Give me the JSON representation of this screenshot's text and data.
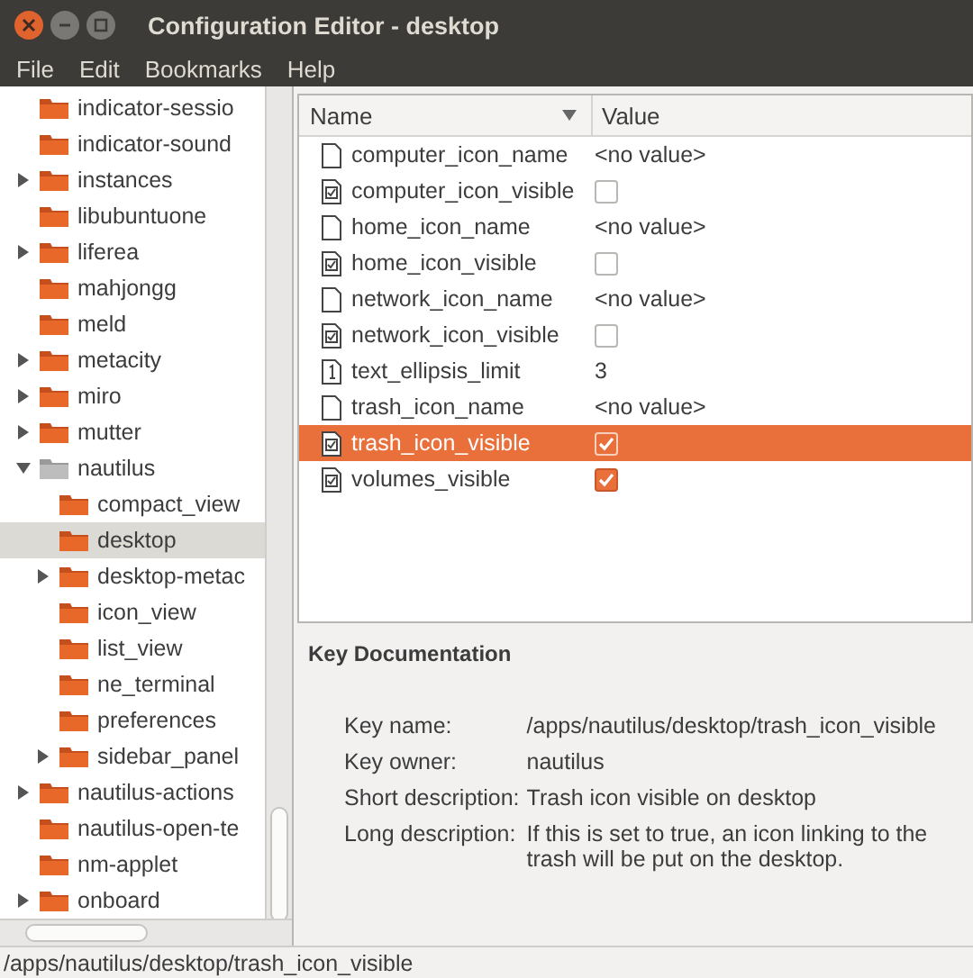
{
  "window": {
    "title": "Configuration Editor - desktop"
  },
  "menu": [
    "File",
    "Edit",
    "Bookmarks",
    "Help"
  ],
  "tree": [
    {
      "label": "indicator-sessio",
      "expandable": false,
      "expanded": false,
      "selected": false
    },
    {
      "label": "indicator-sound",
      "expandable": false,
      "expanded": false,
      "selected": false
    },
    {
      "label": "instances",
      "expandable": true,
      "expanded": false,
      "selected": false
    },
    {
      "label": "libubuntuone",
      "expandable": false,
      "expanded": false,
      "selected": false
    },
    {
      "label": "liferea",
      "expandable": true,
      "expanded": false,
      "selected": false
    },
    {
      "label": "mahjongg",
      "expandable": false,
      "expanded": false,
      "selected": false
    },
    {
      "label": "meld",
      "expandable": false,
      "expanded": false,
      "selected": false
    },
    {
      "label": "metacity",
      "expandable": true,
      "expanded": false,
      "selected": false
    },
    {
      "label": "miro",
      "expandable": true,
      "expanded": false,
      "selected": false
    },
    {
      "label": "mutter",
      "expandable": true,
      "expanded": false,
      "selected": false
    },
    {
      "label": "nautilus",
      "expandable": true,
      "expanded": true,
      "selected": false,
      "children": [
        {
          "label": "compact_view",
          "expandable": false,
          "expanded": false,
          "selected": false
        },
        {
          "label": "desktop",
          "expandable": false,
          "expanded": false,
          "selected": true
        },
        {
          "label": "desktop-metac",
          "expandable": true,
          "expanded": false,
          "selected": false
        },
        {
          "label": "icon_view",
          "expandable": false,
          "expanded": false,
          "selected": false
        },
        {
          "label": "list_view",
          "expandable": false,
          "expanded": false,
          "selected": false
        },
        {
          "label": "ne_terminal",
          "expandable": false,
          "expanded": false,
          "selected": false
        },
        {
          "label": "preferences",
          "expandable": false,
          "expanded": false,
          "selected": false
        },
        {
          "label": "sidebar_panel",
          "expandable": true,
          "expanded": false,
          "selected": false
        }
      ]
    },
    {
      "label": "nautilus-actions",
      "expandable": true,
      "expanded": false,
      "selected": false
    },
    {
      "label": "nautilus-open-te",
      "expandable": false,
      "expanded": false,
      "selected": false
    },
    {
      "label": "nm-applet",
      "expandable": false,
      "expanded": false,
      "selected": false
    },
    {
      "label": "onboard",
      "expandable": true,
      "expanded": false,
      "selected": false
    }
  ],
  "table": {
    "columns": [
      "Name",
      "Value"
    ],
    "rows": [
      {
        "kind": "string",
        "name": "computer_icon_name",
        "value": "<no value>",
        "selected": false
      },
      {
        "kind": "bool",
        "name": "computer_icon_visible",
        "checked": false,
        "selected": false
      },
      {
        "kind": "string",
        "name": "home_icon_name",
        "value": "<no value>",
        "selected": false
      },
      {
        "kind": "bool",
        "name": "home_icon_visible",
        "checked": false,
        "selected": false
      },
      {
        "kind": "string",
        "name": "network_icon_name",
        "value": "<no value>",
        "selected": false
      },
      {
        "kind": "bool",
        "name": "network_icon_visible",
        "checked": false,
        "selected": false
      },
      {
        "kind": "int",
        "name": "text_ellipsis_limit",
        "value": "3",
        "selected": false
      },
      {
        "kind": "string",
        "name": "trash_icon_name",
        "value": "<no value>",
        "selected": false
      },
      {
        "kind": "bool",
        "name": "trash_icon_visible",
        "checked": true,
        "selected": true
      },
      {
        "kind": "bool",
        "name": "volumes_visible",
        "checked": true,
        "selected": false
      }
    ]
  },
  "documentation": {
    "title": "Key Documentation",
    "fields": [
      {
        "label": "Key name:",
        "value": "/apps/nautilus/desktop/trash_icon_visible"
      },
      {
        "label": "Key owner:",
        "value": "nautilus"
      },
      {
        "label": "Short description:",
        "value": "Trash icon visible on desktop"
      },
      {
        "label": "Long description:",
        "value": "If this is set to true, an icon linking to the trash will be put on the desktop."
      }
    ]
  },
  "status_bar": "/apps/nautilus/desktop/trash_icon_visible"
}
